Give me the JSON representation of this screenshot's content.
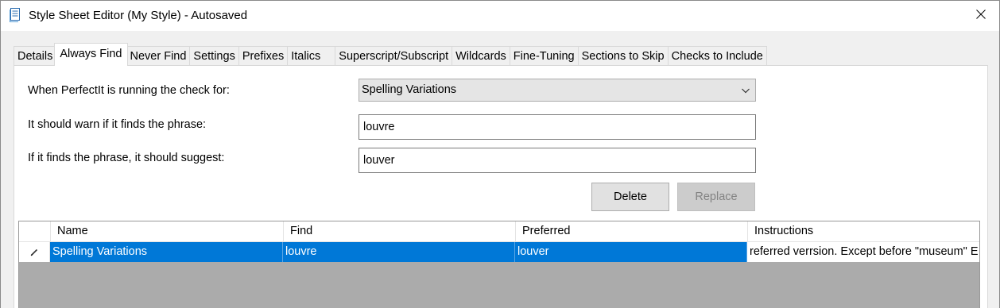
{
  "window": {
    "title": "Style Sheet Editor (My Style) - Autosaved",
    "close_glyph": "✕",
    "app_icon": "document-icon"
  },
  "tabs": [
    {
      "label": "Details",
      "active": false
    },
    {
      "label": "Always Find",
      "active": true
    },
    {
      "label": "Never Find",
      "active": false
    },
    {
      "label": "Settings",
      "active": false
    },
    {
      "label": "Prefixes",
      "active": false
    },
    {
      "label": "Italics",
      "active": false
    },
    {
      "label": "Superscript/Subscript",
      "active": false
    },
    {
      "label": "Wildcards",
      "active": false
    },
    {
      "label": "Fine-Tuning",
      "active": false
    },
    {
      "label": "Sections to Skip",
      "active": false
    },
    {
      "label": "Checks to Include",
      "active": false
    }
  ],
  "form": {
    "check_label": "When PerfectIt is running the check for:",
    "check_value": "Spelling Variations",
    "phrase_label": "It should warn if it finds the phrase:",
    "phrase_value": "louvre",
    "suggest_label": "If it finds the phrase, it should suggest:",
    "suggest_value": "louver"
  },
  "buttons": {
    "delete": "Delete",
    "replace": "Replace"
  },
  "grid": {
    "columns": [
      "Name",
      "Find",
      "Preferred",
      "Instructions"
    ],
    "rows": [
      {
        "name": "Spelling Variations",
        "find": "louvre",
        "preferred": "louver",
        "instructions": "referred verrsion. Except before \"museum\" E",
        "selected": true
      }
    ]
  },
  "colors": {
    "selection": "#0078d7",
    "grid_empty": "#ababab"
  }
}
